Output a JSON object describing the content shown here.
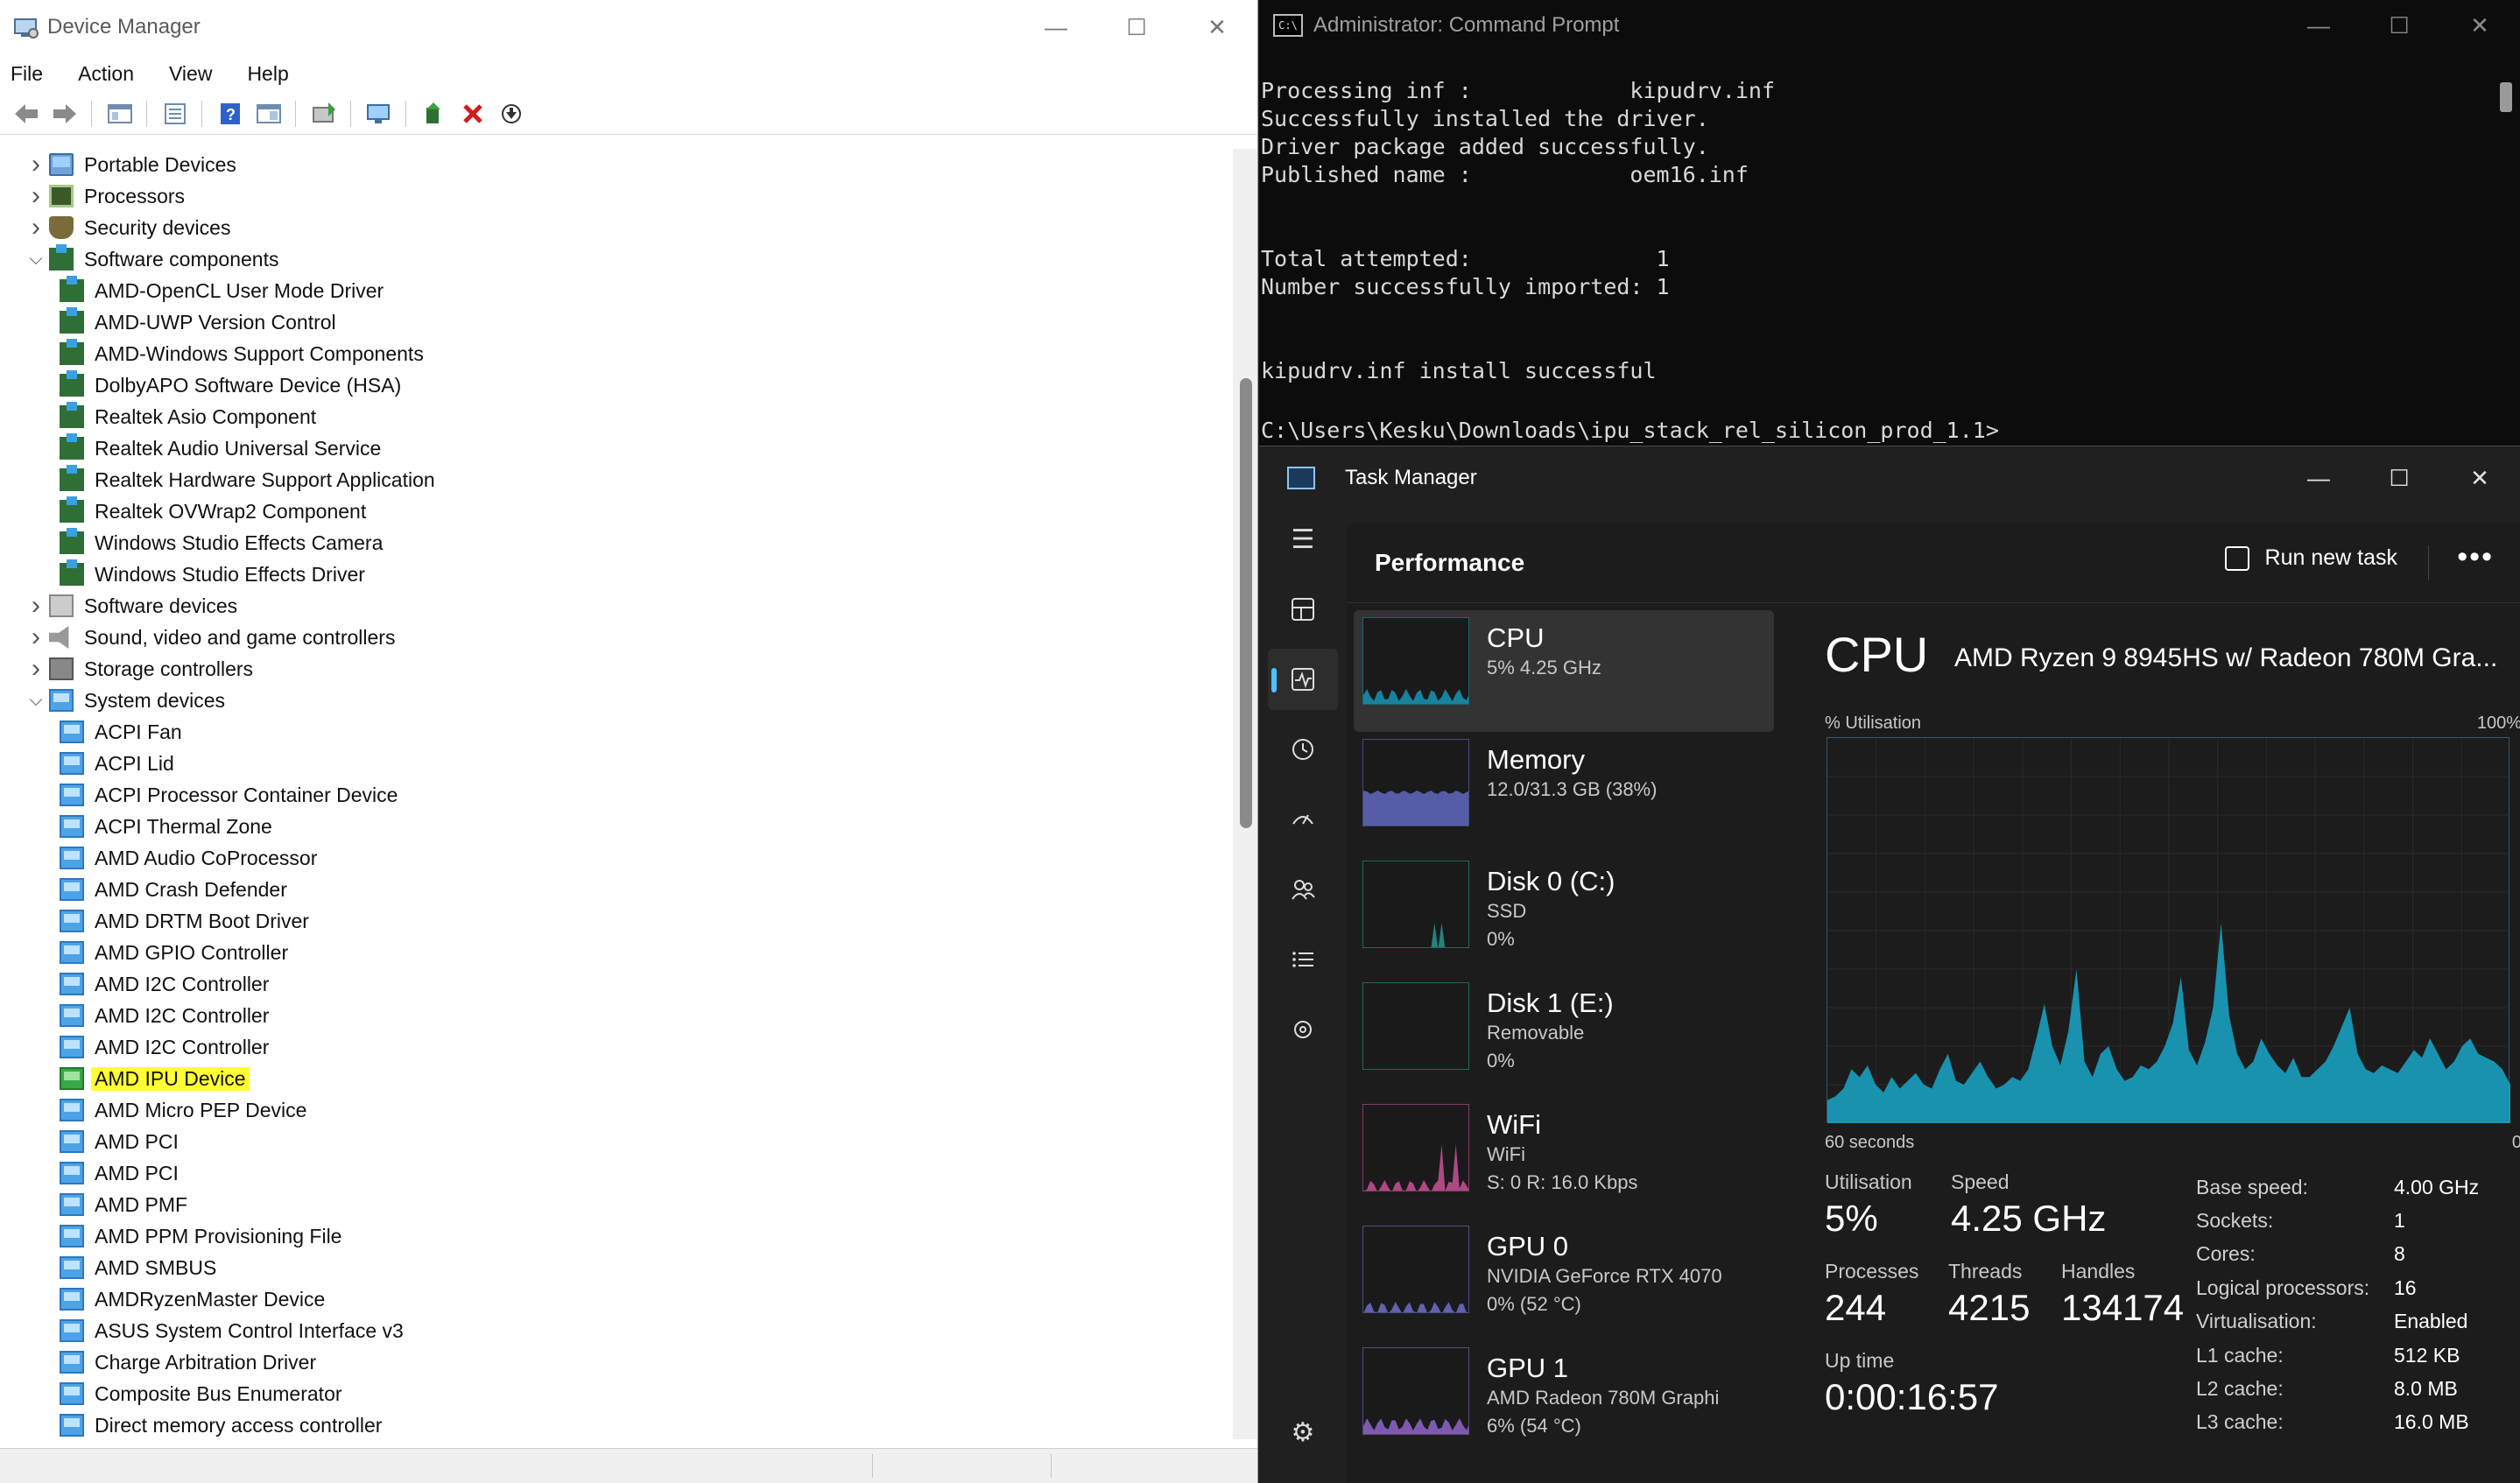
{
  "device_manager": {
    "title": "Device Manager",
    "menu": [
      "File",
      "Action",
      "View",
      "Help"
    ],
    "tree": [
      {
        "label": "Portable Devices",
        "type": "cat",
        "expanded": false
      },
      {
        "label": "Processors",
        "type": "cat",
        "expanded": false
      },
      {
        "label": "Security devices",
        "type": "cat",
        "expanded": false
      },
      {
        "label": "Software components",
        "type": "cat",
        "expanded": true
      },
      {
        "label": "AMD-OpenCL User Mode Driver",
        "type": "child"
      },
      {
        "label": "AMD-UWP Version Control",
        "type": "child"
      },
      {
        "label": "AMD-Windows Support Components",
        "type": "child"
      },
      {
        "label": "DolbyAPO Software Device (HSA)",
        "type": "child"
      },
      {
        "label": "Realtek Asio Component",
        "type": "child"
      },
      {
        "label": "Realtek Audio Universal Service",
        "type": "child"
      },
      {
        "label": "Realtek Hardware Support Application",
        "type": "child"
      },
      {
        "label": "Realtek OVWrap2 Component",
        "type": "child"
      },
      {
        "label": "Windows Studio Effects Camera",
        "type": "child"
      },
      {
        "label": "Windows Studio Effects Driver",
        "type": "child"
      },
      {
        "label": "Software devices",
        "type": "cat",
        "expanded": false
      },
      {
        "label": "Sound, video and game controllers",
        "type": "cat",
        "expanded": false
      },
      {
        "label": "Storage controllers",
        "type": "cat",
        "expanded": false
      },
      {
        "label": "System devices",
        "type": "cat",
        "expanded": true
      },
      {
        "label": "ACPI Fan",
        "type": "child"
      },
      {
        "label": "ACPI Lid",
        "type": "child"
      },
      {
        "label": "ACPI Processor Container Device",
        "type": "child"
      },
      {
        "label": "ACPI Thermal Zone",
        "type": "child"
      },
      {
        "label": "AMD Audio CoProcessor",
        "type": "child"
      },
      {
        "label": "AMD Crash Defender",
        "type": "child"
      },
      {
        "label": "AMD DRTM Boot Driver",
        "type": "child"
      },
      {
        "label": "AMD GPIO Controller",
        "type": "child"
      },
      {
        "label": "AMD I2C Controller",
        "type": "child"
      },
      {
        "label": "AMD I2C Controller",
        "type": "child"
      },
      {
        "label": "AMD I2C Controller",
        "type": "child"
      },
      {
        "label": "AMD IPU Device",
        "type": "child",
        "highlighted": true
      },
      {
        "label": "AMD Micro PEP Device",
        "type": "child"
      },
      {
        "label": "AMD PCI",
        "type": "child"
      },
      {
        "label": "AMD PCI",
        "type": "child"
      },
      {
        "label": "AMD PMF",
        "type": "child"
      },
      {
        "label": "AMD PPM Provisioning File",
        "type": "child"
      },
      {
        "label": "AMD SMBUS",
        "type": "child"
      },
      {
        "label": "AMDRyzenMaster Device",
        "type": "child"
      },
      {
        "label": "ASUS System Control Interface v3",
        "type": "child"
      },
      {
        "label": "Charge Arbitration Driver",
        "type": "child"
      },
      {
        "label": "Composite Bus Enumerator",
        "type": "child"
      },
      {
        "label": "Direct memory access controller",
        "type": "child"
      }
    ],
    "highlight_color": "#ffff33"
  },
  "cmd": {
    "title": "Administrator: Command Prompt",
    "lines": [
      "Processing inf :            kipudrv.inf",
      "Successfully installed the driver.",
      "Driver package added successfully.",
      "Published name :            oem16.inf",
      "",
      "",
      "Total attempted:              1",
      "Number successfully imported: 1",
      "",
      "",
      "kipudrv.inf install successful",
      "",
      "C:\\Users\\Kesku\\Downloads\\ipu_stack_rel_silicon_prod_1.1>"
    ]
  },
  "task_manager": {
    "title": "Task Manager",
    "page_title": "Performance",
    "run_new_task": "Run new task",
    "more": "•••",
    "devices": [
      {
        "name": "CPU",
        "sub1": "5% 4.25 GHz",
        "sub2": "",
        "color": "#17a7c8",
        "active": true,
        "level": 0.05
      },
      {
        "name": "Memory",
        "sub1": "12.0/31.3 GB (38%)",
        "sub2": "",
        "color": "#6b74d6",
        "level": 0.38
      },
      {
        "name": "Disk 0 (C:)",
        "sub1": "SSD",
        "sub2": "0%",
        "color": "#2aa79a",
        "level": 0.0
      },
      {
        "name": "Disk 1 (E:)",
        "sub1": "Removable",
        "sub2": "0%",
        "color": "#2aa79a",
        "level": 0.0
      },
      {
        "name": "WiFi",
        "sub1": "WiFi",
        "sub2": "S: 0 R: 16.0 Kbps",
        "color": "#e05aa8",
        "level": 0.0
      },
      {
        "name": "GPU 0",
        "sub1": "NVIDIA GeForce RTX 4070",
        "sub2": "0% (52 °C)",
        "color": "#7a7ae0",
        "level": 0.0
      },
      {
        "name": "GPU 1",
        "sub1": "AMD Radeon 780M Graphi",
        "sub2": "6% (54 °C)",
        "color": "#a070e0",
        "level": 0.06
      }
    ],
    "detail": {
      "heading": "CPU",
      "model": "AMD Ryzen 9 8945HS w/ Radeon 780M Gra...",
      "util_label": "% Utilisation",
      "util_max": "100%",
      "time_left": "60 seconds",
      "time_right": "0",
      "utilisation_label": "Utilisation",
      "utilisation": "5%",
      "speed_label": "Speed",
      "speed": "4.25 GHz",
      "processes_label": "Processes",
      "processes": "244",
      "threads_label": "Threads",
      "threads": "4215",
      "handles_label": "Handles",
      "handles": "134174",
      "uptime_label": "Up time",
      "uptime": "0:00:16:57",
      "specs": [
        {
          "k": "Base speed:",
          "v": "4.00 GHz"
        },
        {
          "k": "Sockets:",
          "v": "1"
        },
        {
          "k": "Cores:",
          "v": "8"
        },
        {
          "k": "Logical processors:",
          "v": "16"
        },
        {
          "k": "Virtualisation:",
          "v": "Enabled"
        },
        {
          "k": "L1 cache:",
          "v": "512 KB"
        },
        {
          "k": "L2 cache:",
          "v": "8.0 MB"
        },
        {
          "k": "L3 cache:",
          "v": "16.0 MB"
        }
      ],
      "graph_color": "#17a7c8",
      "graph_values": [
        6,
        7,
        9,
        14,
        12,
        15,
        10,
        8,
        12,
        9,
        11,
        13,
        10,
        9,
        14,
        18,
        11,
        10,
        13,
        16,
        12,
        9,
        10,
        12,
        11,
        14,
        22,
        31,
        20,
        15,
        24,
        40,
        16,
        12,
        18,
        20,
        14,
        11,
        12,
        15,
        14,
        16,
        20,
        26,
        38,
        19,
        15,
        21,
        30,
        52,
        28,
        18,
        14,
        16,
        22,
        18,
        15,
        13,
        17,
        12,
        12,
        14,
        16,
        20,
        25,
        30,
        18,
        14,
        13,
        15,
        14,
        13,
        16,
        19,
        17,
        22,
        18,
        14,
        16,
        20,
        22,
        18,
        17,
        16,
        14,
        10
      ]
    }
  }
}
